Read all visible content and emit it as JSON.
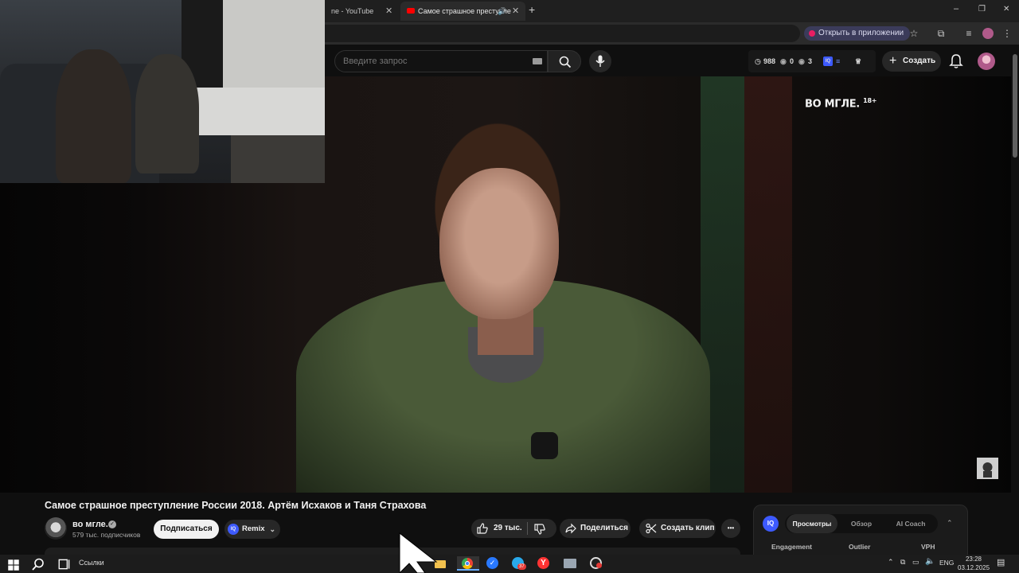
{
  "browser": {
    "tabs": [
      {
        "label": "ne - YouTube",
        "active": false
      },
      {
        "label": "Самое страшное преступле",
        "active": true
      }
    ],
    "new_tab_symbol": "+",
    "close_symbol": "✕",
    "open_in_app_label": "Открыть в приложении",
    "window_controls": {
      "minimize": "–",
      "restore": "❐",
      "close": "✕"
    }
  },
  "youtube": {
    "search_placeholder": "Введите запрос",
    "stats": {
      "views": "988",
      "second": "0",
      "third": "3"
    },
    "create_label": "Создать",
    "icons": [
      "search-icon",
      "mic-icon",
      "bell-icon",
      "keyboard-icon"
    ]
  },
  "video": {
    "brand_mark": "ВО МГЛЕ.",
    "age_rating": "18+",
    "title": "Самое страшное преступление России 2018. Артём Исхаков и Таня Страхова"
  },
  "channel": {
    "name": "во мгле.",
    "subscribers": "579 тыс. подписчиков",
    "subscribe_label": "Подписаться",
    "remix_label": "Remix",
    "remix_badge": "IQ"
  },
  "actions": {
    "likes": "29 тыс.",
    "share_label": "Поделиться",
    "clip_label": "Создать клип",
    "more_symbol": "•••"
  },
  "side_panel": {
    "badge": "IQ",
    "tabs": [
      {
        "label": "Просмотры",
        "active": true
      },
      {
        "label": "Обзор",
        "active": false
      },
      {
        "label": "AI Coach",
        "active": false
      }
    ],
    "columns": [
      "Engagement",
      "Outlier",
      "VPH"
    ]
  },
  "taskbar": {
    "links_label": "Ссылки",
    "language": "ENG",
    "time": "23:28",
    "date": "03.12.2025",
    "telegram_badge": "37"
  },
  "colors": {
    "yt_background": "#0f0f0f",
    "accent_blue": "#3d5afe",
    "yt_red": "#ff0000"
  }
}
